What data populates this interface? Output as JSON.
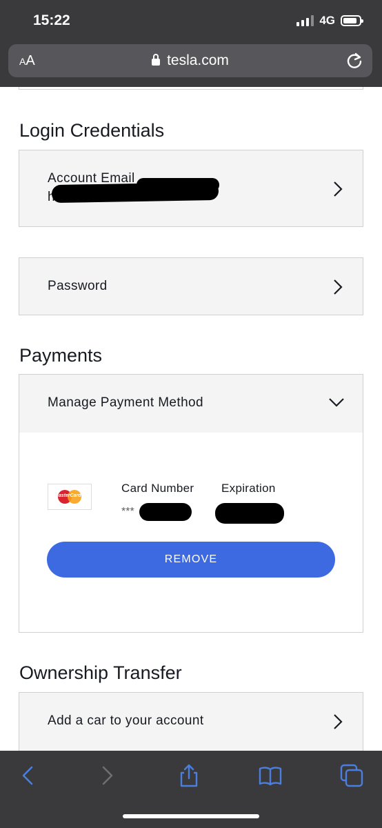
{
  "status_bar": {
    "time": "15:22",
    "network": "4G"
  },
  "address_bar": {
    "aa_small": "A",
    "aa_large": "A",
    "domain": "tesla.com"
  },
  "login": {
    "title": "Login Credentials",
    "email_label": "Account Email",
    "email_visible_fragment": "he",
    "password_label": "Password"
  },
  "payments": {
    "title": "Payments",
    "manage_label": "Manage Payment Method",
    "card_brand": "MasterCard",
    "card_number_label": "Card Number",
    "expiration_label": "Expiration",
    "card_number_masked": "***",
    "remove_label": "REMOVE"
  },
  "ownership": {
    "title": "Ownership Transfer",
    "add_car_label": "Add a car to your account"
  },
  "colors": {
    "chrome_bg": "#3a3a3c",
    "address_bg": "#57575b",
    "accent_blue": "#3e6ae1",
    "toolbar_icon_blue": "#4a7fe0",
    "row_bg": "#f4f4f4",
    "border": "#d0d0d0"
  },
  "toolbar": {
    "icons": [
      "back-icon",
      "forward-icon",
      "share-icon",
      "bookmarks-icon",
      "tabs-icon"
    ]
  }
}
